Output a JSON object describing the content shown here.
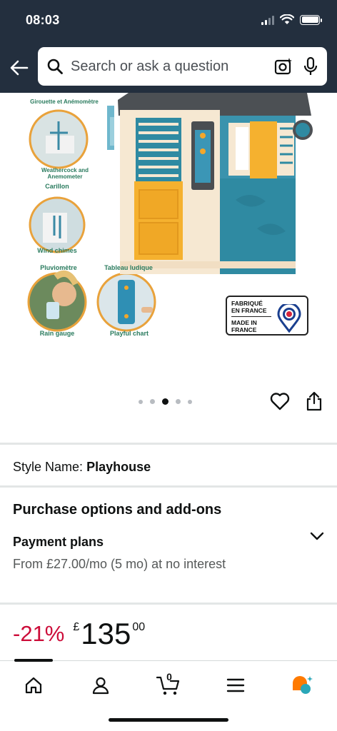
{
  "status_bar": {
    "time": "08:03"
  },
  "header": {
    "search_placeholder": "Search or ask a question"
  },
  "product_image": {
    "callouts": [
      "Girouette et Anémomètre",
      "Weathercock and Anemometer",
      "Carillon",
      "Wind chimes",
      "Pluviomètre",
      "Rain gauge",
      "Tableau ludique",
      "Playful chart"
    ],
    "badge": {
      "line1": "FABRIQUÉ",
      "line2": "EN FRANCE",
      "line3": "MADE IN",
      "line4": "FRANCE"
    }
  },
  "carousel": {
    "total": 5,
    "active_index": 2
  },
  "style": {
    "label": "Style Name:",
    "value": "Playhouse"
  },
  "purchase": {
    "title": "Purchase options and add-ons",
    "payment_plans_title": "Payment plans",
    "payment_plans_desc": "From £27.00/mo (5 mo) at no interest"
  },
  "price": {
    "discount": "-21%",
    "currency": "£",
    "whole": "135",
    "fraction": "00"
  },
  "bottom_nav": {
    "cart_count": "0",
    "items": [
      "home-icon",
      "account-icon",
      "cart-icon",
      "menu-icon",
      "rufus-icon"
    ]
  },
  "colors": {
    "header_bg": "#232f3e",
    "discount": "#cc0c39",
    "accent_orange": "#ff7a00",
    "accent_teal": "#2aa7b8"
  }
}
